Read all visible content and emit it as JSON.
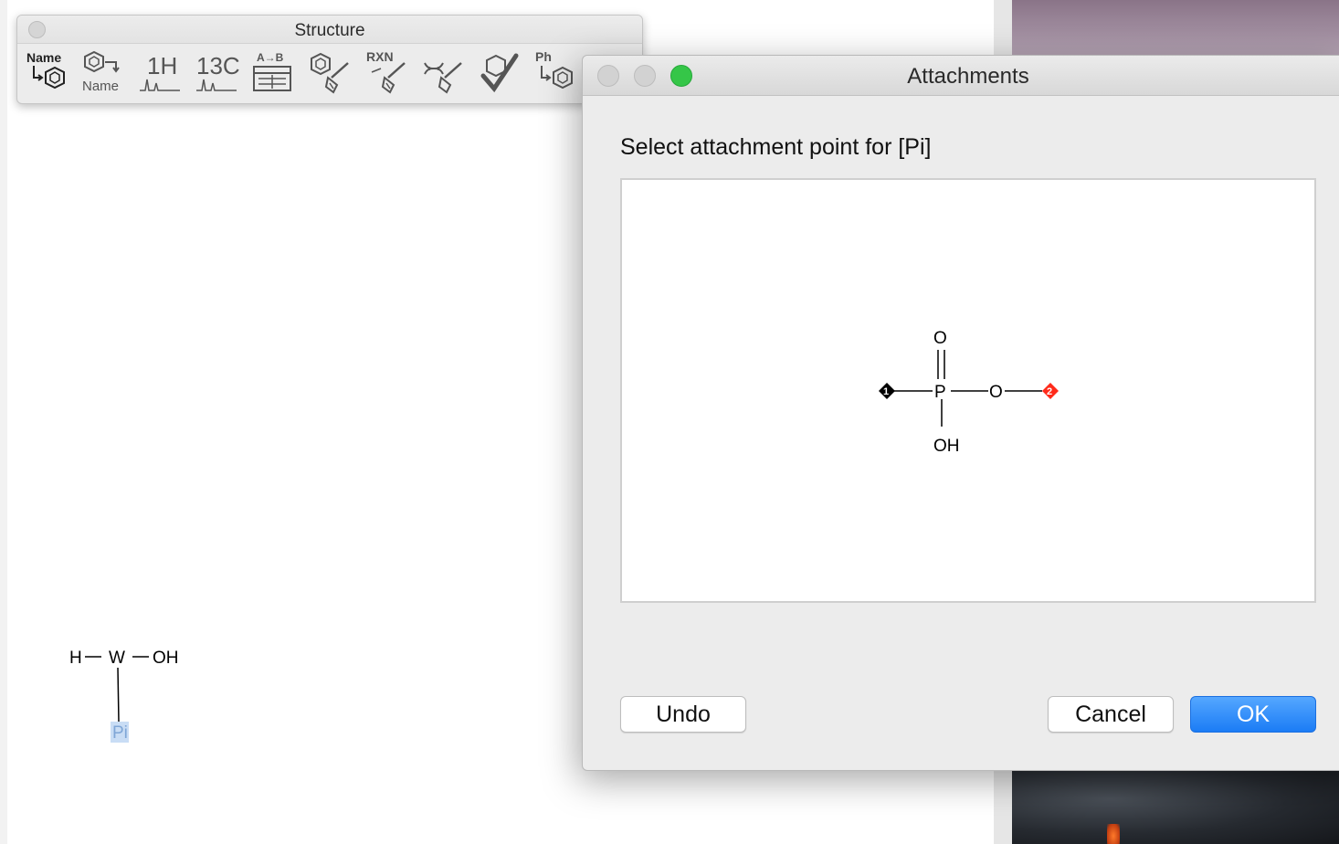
{
  "structure_palette": {
    "title": "Structure",
    "tools": [
      {
        "id": "name-to-structure",
        "label_top": "Name"
      },
      {
        "id": "structure-to-name",
        "label_bottom": "Name"
      },
      {
        "id": "predict-1h-nmr",
        "label_top": "1H"
      },
      {
        "id": "predict-13c-nmr",
        "label_top": "13C"
      },
      {
        "id": "reaction-table",
        "label_top": "A→B"
      },
      {
        "id": "clean-structure"
      },
      {
        "id": "clean-reaction",
        "label_top": "RXN"
      },
      {
        "id": "clean-biopolymer"
      },
      {
        "id": "check-structure"
      },
      {
        "id": "expand-label",
        "label_top": "Ph"
      }
    ]
  },
  "dialog": {
    "title": "Attachments",
    "prompt": "Select attachment point for [Pi]",
    "buttons": {
      "undo": "Undo",
      "cancel": "Cancel",
      "ok": "OK"
    },
    "molecule": {
      "center_atom": "P",
      "top_atom": "O",
      "bottom_atom": "OH",
      "right_atom": "O",
      "attachment_point_1": "1",
      "attachment_point_2": "2",
      "colors": {
        "point_1": "#000000",
        "point_2": "#ff2a1a"
      }
    }
  },
  "canvas_molecule": {
    "atom_h": "H",
    "atom_w": "W",
    "atom_oh": "OH",
    "atom_pi": "Pi",
    "selection_color": "#c9ddf5",
    "pi_color": "#7fa6d6"
  },
  "colors": {
    "ok_button": "#1b7cf5",
    "zoom_button": "#35c648"
  }
}
